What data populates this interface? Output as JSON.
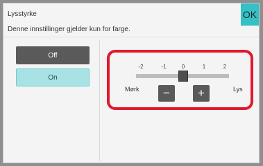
{
  "header": {
    "title": "Lysstyrke",
    "subtitle": "Denne innstillinger gjelder kun for farge.",
    "ok_label": "OK"
  },
  "options": [
    {
      "label": "Off",
      "selected": false
    },
    {
      "label": "On",
      "selected": true
    }
  ],
  "slider": {
    "ticks": [
      "-2",
      "-1",
      "0",
      "1",
      "2"
    ],
    "value": 0,
    "min_label": "Mørk",
    "max_label": "Lys",
    "minus_icon": "−",
    "plus_icon": "+"
  },
  "colors": {
    "accent": "#35c0c6",
    "highlight": "#e0192d"
  }
}
